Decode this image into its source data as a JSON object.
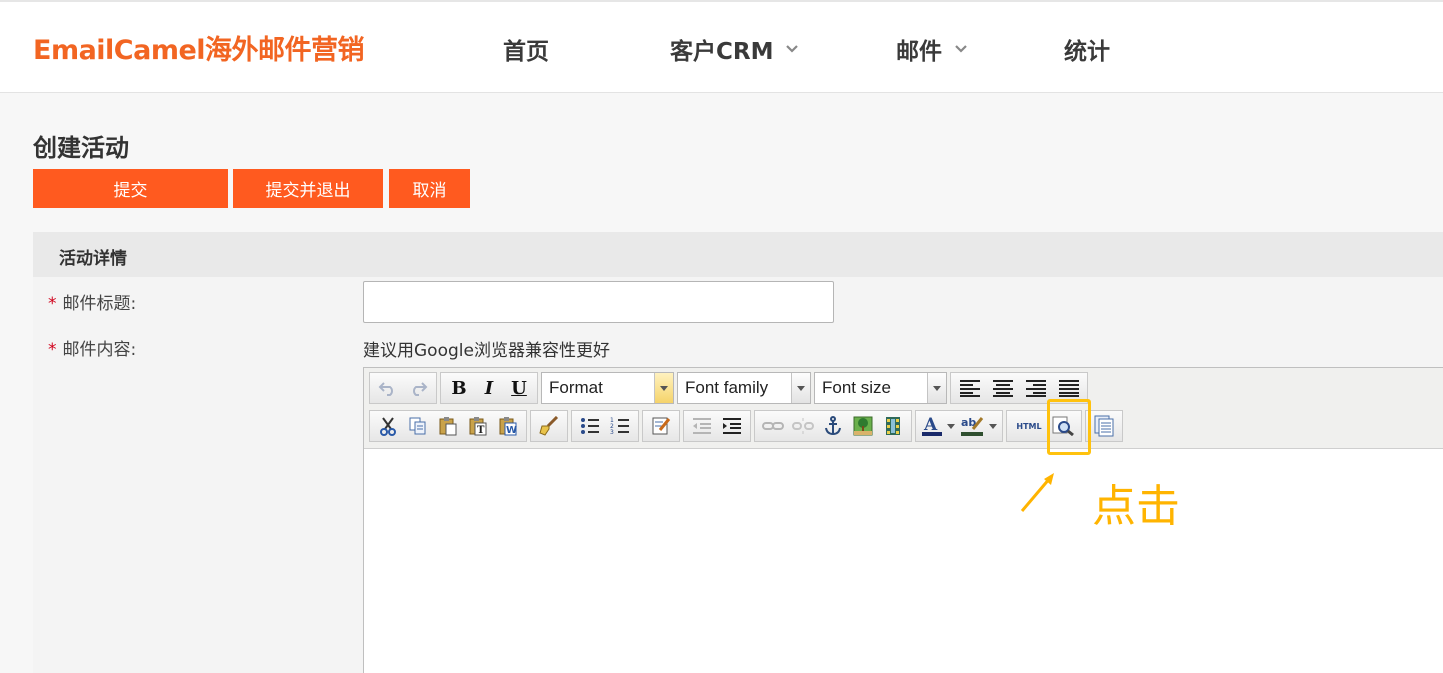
{
  "header": {
    "logo": "EmailCamel海外邮件营销",
    "nav": [
      {
        "label": "首页",
        "has_dropdown": false
      },
      {
        "label": "客户CRM",
        "has_dropdown": true
      },
      {
        "label": "邮件",
        "has_dropdown": true
      },
      {
        "label": "统计",
        "has_dropdown": false
      }
    ]
  },
  "page": {
    "title": "创建活动",
    "actions": {
      "submit": "提交",
      "submit_exit": "提交并退出",
      "cancel": "取消"
    }
  },
  "form": {
    "section_title": "活动详情",
    "required_mark": "*",
    "subject_label": "邮件标题:",
    "subject_value": "",
    "content_label": "邮件内容:",
    "content_hint": "建议用Google浏览器兼容性更好"
  },
  "editor": {
    "format_select": "Format",
    "font_family_select": "Font family",
    "font_size_select": "Font size",
    "bold": "B",
    "italic": "I",
    "underline": "U",
    "html_button_label": "HTML",
    "highlight_color": "#ffc20e"
  },
  "annotation": {
    "text": "点击",
    "color": "#ffb400"
  },
  "colors": {
    "brand": "#f26522",
    "button": "#ff5a1f",
    "required": "#d0021b"
  }
}
